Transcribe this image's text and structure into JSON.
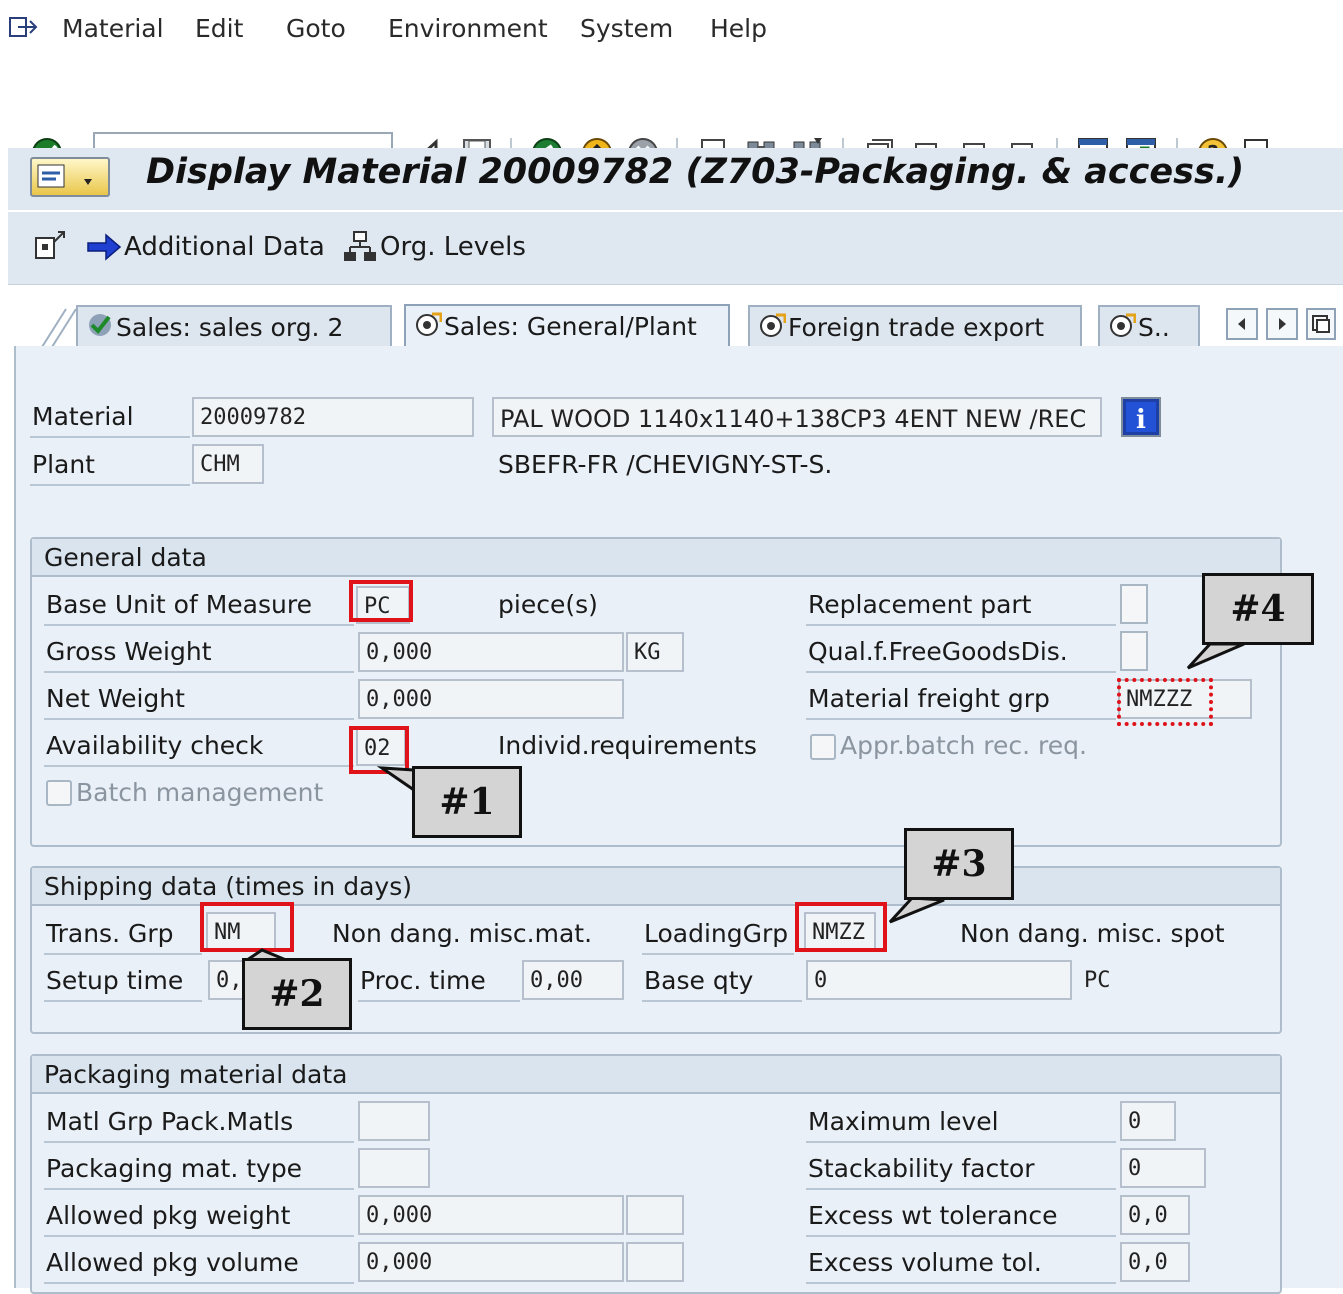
{
  "menu": {
    "items": [
      "Material",
      "Edit",
      "Goto",
      "Environment",
      "System",
      "Help"
    ]
  },
  "toolbar": {
    "command_field_value": ""
  },
  "title": {
    "text": "Display Material 20009782 (Z703-Packaging. & access.)"
  },
  "app_toolbar": {
    "additional_data": "Additional Data",
    "org_levels": "Org. Levels"
  },
  "tabs": [
    {
      "label": "Sales: sales org. 2",
      "active": false
    },
    {
      "label": "Sales: General/Plant",
      "active": true
    },
    {
      "label": "Foreign trade export",
      "active": false
    },
    {
      "label": "S..",
      "active": false
    }
  ],
  "header": {
    "material_label": "Material",
    "material_value": "20009782",
    "material_desc": "PAL WOOD  1140x1140+138CP3 4ENT NEW /REC",
    "plant_label": "Plant",
    "plant_value": "CHM",
    "plant_desc": "SBEFR-FR  /CHEVIGNY-ST-S."
  },
  "general": {
    "title": "General data",
    "base_uom_label": "Base Unit of Measure",
    "base_uom_value": "PC",
    "base_uom_desc": "piece(s)",
    "gross_weight_label": "Gross Weight",
    "gross_weight_value": "0,000",
    "gross_weight_unit": "KG",
    "net_weight_label": "Net Weight",
    "net_weight_value": "0,000",
    "availability_label": "Availability check",
    "availability_value": "02",
    "availability_desc": "Individ.requirements",
    "batch_mgmt_label": "Batch management",
    "replacement_label": "Replacement part",
    "qual_free_label": "Qual.f.FreeGoodsDis.",
    "freight_grp_label": "Material freight grp",
    "freight_grp_value": "NMZZZ",
    "appr_batch_label": "Appr.batch rec. req."
  },
  "shipping": {
    "title": "Shipping data (times in days)",
    "trans_grp_label": "Trans. Grp",
    "trans_grp_value": "NM",
    "trans_grp_desc": "Non dang. misc.mat.",
    "loading_grp_label": "LoadingGrp",
    "loading_grp_value": "NMZZ",
    "loading_grp_desc": "Non dang. misc. spot",
    "setup_time_label": "Setup time",
    "setup_time_value": "0,",
    "proc_time_label": "Proc. time",
    "proc_time_value": "0,00",
    "base_qty_label": "Base qty",
    "base_qty_value": "0",
    "base_qty_unit": "PC"
  },
  "packaging": {
    "title": "Packaging material data",
    "matl_grp_label": "Matl Grp Pack.Matls",
    "matl_grp_value": "",
    "pkg_type_label": "Packaging mat. type",
    "pkg_type_value": "",
    "allowed_weight_label": "Allowed pkg weight",
    "allowed_weight_value": "0,000",
    "allowed_volume_label": "Allowed pkg volume",
    "allowed_volume_value": "0,000",
    "max_level_label": "Maximum level",
    "max_level_value": "0",
    "stackability_label": "Stackability factor",
    "stackability_value": "0",
    "excess_wt_label": "Excess wt tolerance",
    "excess_wt_value": "0,0",
    "excess_vol_label": "Excess volume tol.",
    "excess_vol_value": "0,0"
  },
  "callouts": {
    "c1": "#1",
    "c2": "#2",
    "c3": "#3",
    "c4": "#4"
  },
  "colors": {
    "highlight": "#e0131b",
    "panel": "#e9f0f7",
    "title_bar": "#dfe8f1"
  }
}
